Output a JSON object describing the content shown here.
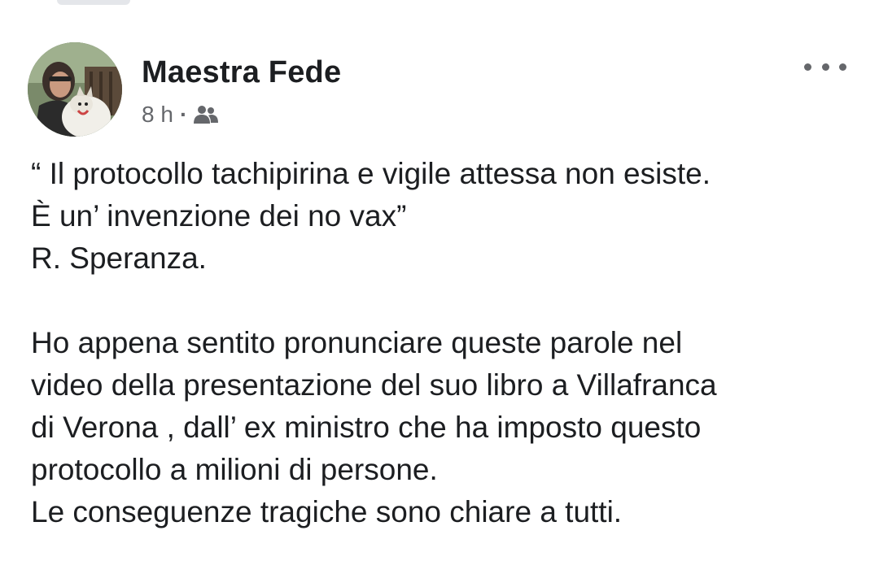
{
  "post": {
    "author": "Maestra Fede",
    "time": "8 h",
    "separator": "·",
    "audience_icon": "friends-icon",
    "more_icon": "more-options-icon",
    "avatar_alt": "profile-photo",
    "quote_lines": [
      "“ Il protocollo tachipirina e vigile attessa non esiste.",
      "È un’ invenzione dei no vax”",
      "R. Speranza."
    ],
    "body_lines": [
      "Ho appena sentito pronunciare queste parole  nel",
      "video della presentazione del suo libro a Villafranca",
      "di Verona , dall’ ex ministro che ha imposto questo",
      "protocollo a milioni di persone.",
      "Le conseguenze tragiche sono chiare a tutti."
    ]
  },
  "colors": {
    "text": "#1c1e21",
    "secondary_text": "#65676b",
    "background": "#ffffff"
  }
}
